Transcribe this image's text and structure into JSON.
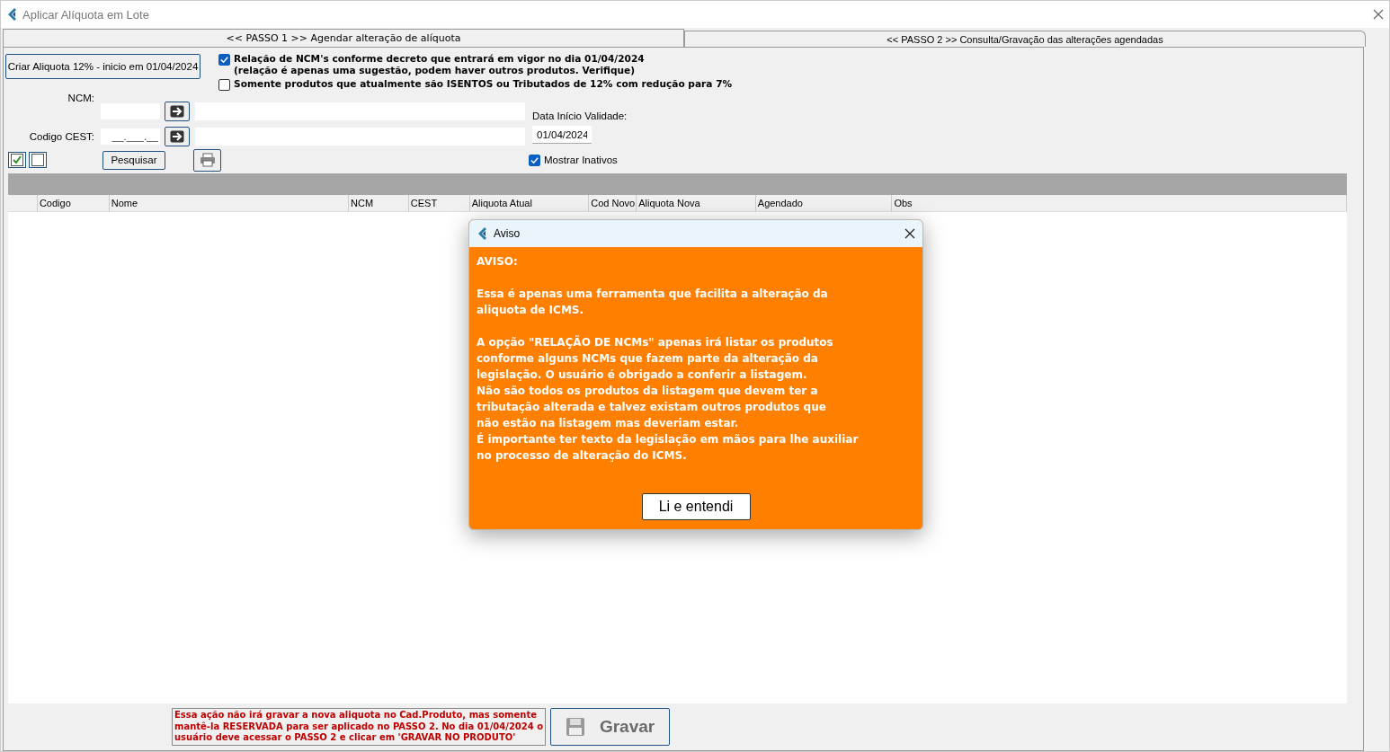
{
  "window": {
    "title": "Aplicar Alíquota em Lote"
  },
  "tabs": [
    {
      "label": "<< PASSO 1 >> Agendar alteração de alíquota",
      "selected": true
    },
    {
      "label": "<< PASSO 2 >> Consulta/Gravação das alterações agendadas",
      "selected": false
    }
  ],
  "create_button": "Criar Aliquota 12% - inicio em 01/04/2024",
  "options": [
    {
      "lines": [
        "Relação de NCM's conforme decreto que entrará em vigor no dia 01/04/2024",
        "(relação é apenas uma sugestão, podem haver outros produtos. Verifique)"
      ],
      "checked": true
    },
    {
      "lines": [
        "Somente produtos que atualmente são ISENTOS ou Tributados de 12% com redução para 7%"
      ],
      "checked": false
    }
  ],
  "ncm": {
    "label": "NCM:"
  },
  "cest": {
    "label": "Codigo CEST:",
    "placeholder": "__.___.__"
  },
  "validity": {
    "label": "Data Início Validade:",
    "value": "01/04/2024"
  },
  "select_buttons": [
    {
      "kind": "check-all"
    },
    {
      "kind": "uncheck-all"
    }
  ],
  "search_button": "Pesquisar",
  "show_inactive": {
    "label": "Mostrar Inativos",
    "checked": true
  },
  "table": {
    "columns": [
      "",
      "Codigo",
      "Nome",
      "NCM",
      "CEST",
      "Aliquota Atual",
      "Cod Novo",
      "Aliquota Nova",
      "Agendado",
      "Obs"
    ]
  },
  "footer": {
    "notice": [
      "Essa ação não irá gravar a nova aliquota no Cad.Produto, mas somente",
      "mantê-la RESERVADA para ser aplicado no PASSO 2. No dia 01/04/2024 o",
      "usuário deve acessar o PASSO 2 e clicar em 'GRAVAR NO PRODUTO'"
    ],
    "save_button": "Gravar"
  },
  "dialog": {
    "title": "Aviso",
    "heading": "AVISO:",
    "paragraphs": [
      [
        "Essa é apenas uma ferramenta que facilita a alteração da",
        "aliquota de ICMS."
      ],
      [
        "A opção \"RELAÇÃO DE NCMs\" apenas irá listar os produtos",
        "conforme alguns NCMs que fazem parte da alteração da",
        "legislação. O usuário é obrigado a conferir a listagem.",
        "Não são todos os produtos da listagem que devem ter a",
        "tributação alterada e talvez existam outros produtos que",
        "não estão na listagem mas deveriam estar.",
        "É importante ter texto da legislação em mãos para lhe auxiliar",
        "no processo de alteração do ICMS."
      ]
    ],
    "button": "Li e entendi"
  }
}
